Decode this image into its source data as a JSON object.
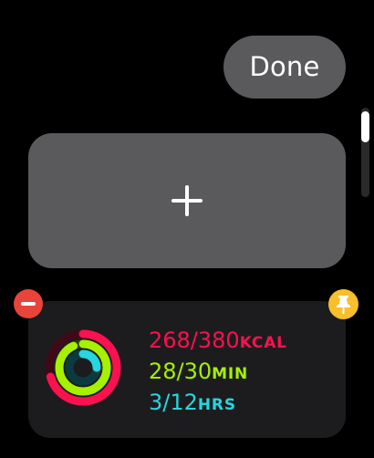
{
  "header": {
    "done_label": "Done"
  },
  "activity": {
    "move": {
      "value": "268/380",
      "unit": "KCAL",
      "progress": 0.705
    },
    "exercise": {
      "value": "28/30",
      "unit": "MIN",
      "progress": 0.933
    },
    "stand": {
      "value": "3/12",
      "unit": "HRS",
      "progress": 0.25
    }
  },
  "colors": {
    "move": "#fa114f",
    "exercise": "#a6f000",
    "stand": "#26d6e0",
    "remove": "#e8443a",
    "pin": "#f7bf2b"
  },
  "icons": {
    "add": "plus-icon",
    "remove": "minus-icon",
    "pin": "pin-icon"
  }
}
